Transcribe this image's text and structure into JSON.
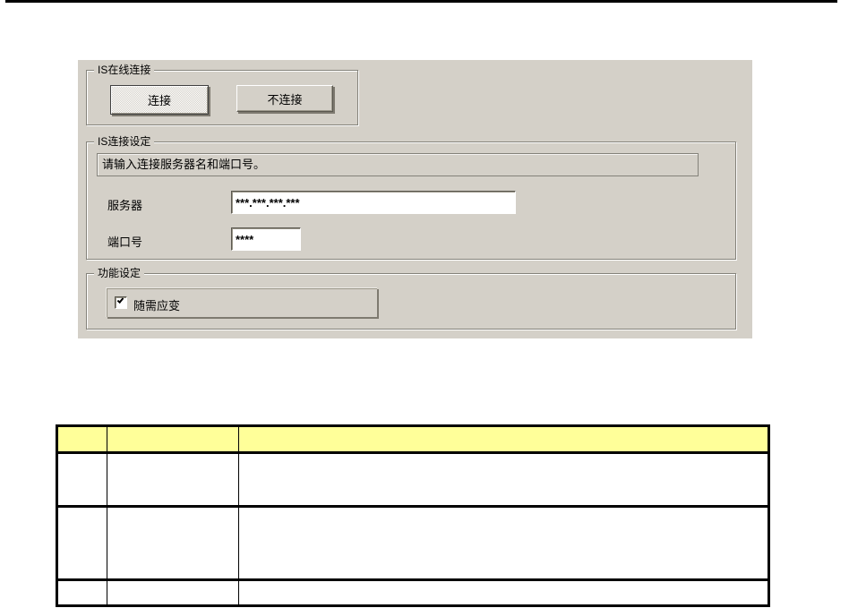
{
  "page": {
    "background": "#ffffff",
    "rule_color": "#000000"
  },
  "dialog": {
    "background": "#d4d0c8",
    "online_group": {
      "title": "IS在线连接",
      "connect_label": "连接",
      "disconnect_label": "不连接"
    },
    "settings_group": {
      "title": "IS连接设定",
      "instruction": "请输入连接服务器名和端口号。",
      "server": {
        "label": "服务器",
        "value": "***.***.***.***"
      },
      "port": {
        "label": "端口号",
        "value": "****"
      }
    },
    "function_group": {
      "title": "功能设定",
      "checkbox": {
        "label": "随需应变",
        "checked": true
      }
    }
  },
  "table": {
    "header_background": "#ffff99",
    "border_color": "#000000",
    "headers": [
      "",
      "",
      ""
    ],
    "rows": [
      [
        "",
        "",
        ""
      ],
      [
        "",
        "",
        ""
      ],
      [
        "",
        "",
        ""
      ]
    ]
  }
}
